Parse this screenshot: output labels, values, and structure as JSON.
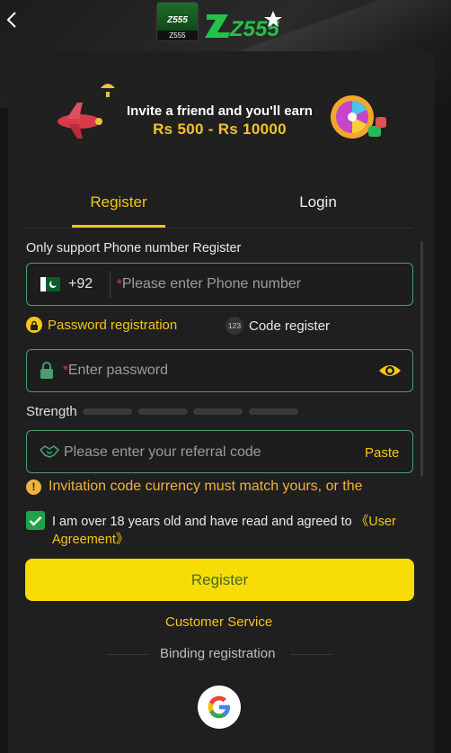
{
  "header": {
    "back_icon": "chevron-left-icon",
    "logo_small_caption": "Z555",
    "logo_text": "Z555"
  },
  "banner": {
    "line1": "Invite a friend and you'll earn",
    "line2": "Rs 500 - Rs 10000"
  },
  "tabs": [
    {
      "label": "Register",
      "active": true
    },
    {
      "label": "Login",
      "active": false
    }
  ],
  "form": {
    "hint": "Only support Phone number Register",
    "phone": {
      "country_code": "+92",
      "required_mark": "*",
      "placeholder": "Please enter Phone number",
      "flag": "pakistan-flag-icon"
    },
    "modes": {
      "password_label": "Password registration",
      "code_badge": "123",
      "code_label": "Code register"
    },
    "password": {
      "required_mark": "*",
      "placeholder": "Enter password"
    },
    "strength_label": "Strength",
    "strength_level": 0,
    "referral": {
      "placeholder": "Please enter your referral code",
      "paste_label": "Paste"
    },
    "warning": "Invitation code currency must match yours, or the",
    "agreement": {
      "checked": true,
      "text": "I am over 18 years old and have read and agreed to ",
      "link": "《User Agreement》"
    },
    "register_button": "Register"
  },
  "footer": {
    "customer_service": "Customer Service",
    "binding_registration": "Binding registration",
    "google_icon": "google-icon"
  },
  "colors": {
    "accent_yellow": "#f5c518",
    "field_border": "#4a9e6d",
    "button_bg": "#f8dc05",
    "background": "#1f1f1f"
  }
}
